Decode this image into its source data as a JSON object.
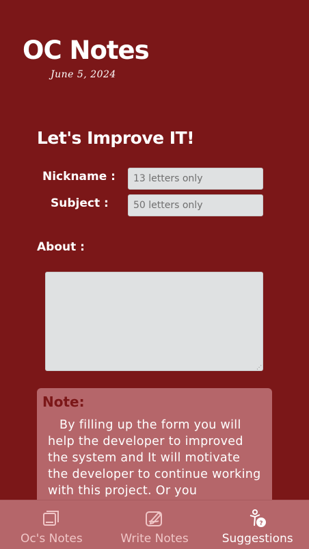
{
  "app": {
    "title": "OC Notes",
    "date": "June 5, 2024"
  },
  "form": {
    "heading": "Let's Improve IT!",
    "nickname_label": "Nickname :",
    "nickname_placeholder": "13 letters only",
    "subject_label": "Subject :",
    "subject_placeholder": "50 letters only",
    "about_label": "About :"
  },
  "note": {
    "title": "Note:",
    "body": "By filling up the form you will help the developer to improved the system and It will motivate the developer to continue working with this project. Or you"
  },
  "nav": {
    "items": [
      {
        "label": "Oc's Notes",
        "icon": "notes-icon"
      },
      {
        "label": "Write Notes",
        "icon": "write-icon"
      },
      {
        "label": "Suggestions",
        "icon": "suggestions-icon",
        "active": true
      }
    ]
  },
  "colors": {
    "background": "#7b1718",
    "card": "#b5666a",
    "input": "#dfe1e2"
  }
}
